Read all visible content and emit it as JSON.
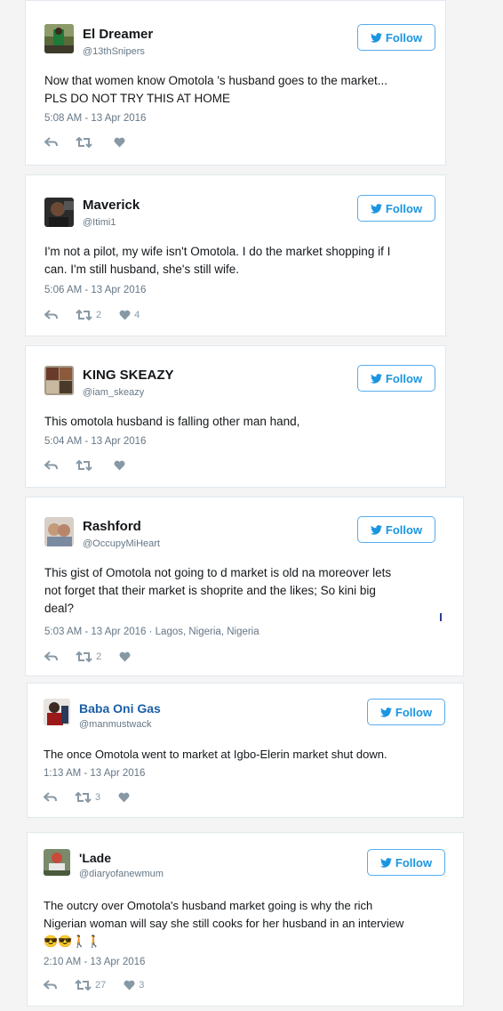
{
  "follow_label": "Follow",
  "icons": {
    "follow": "twitter-bird-icon",
    "reply": "reply-icon",
    "retweet": "retweet-icon",
    "like": "heart-icon"
  },
  "colors": {
    "accent": "#1b95e0",
    "name_blue": "#1b5ea6",
    "muted": "#657786"
  },
  "tweets": [
    {
      "name": "El Dreamer",
      "handle": "@13thSnipers",
      "text": [
        "Now that women know Omotola 's husband goes to the market...",
        "PLS DO NOT TRY THIS AT HOME"
      ],
      "time": "5:08 AM - 13 Apr 2016",
      "retweets": "",
      "likes": ""
    },
    {
      "name": "Maverick",
      "handle": "@Itimi1",
      "text": [
        "I'm not a pilot, my wife isn't Omotola. I do the market shopping if I",
        "can. I'm still husband, she's still wife."
      ],
      "time": "5:06 AM - 13 Apr 2016",
      "retweets": "2",
      "likes": "4"
    },
    {
      "name": "KING SKEAZY",
      "handle": "@iam_skeazy",
      "text": [
        "This omotola husband is falling other man hand,"
      ],
      "time": "5:04 AM - 13 Apr 2016",
      "retweets": "",
      "likes": ""
    },
    {
      "name": "Rashford",
      "handle": "@OccupyMiHeart",
      "text": [
        "This gist of Omotola not going to d market is old na moreover lets",
        "not forget that their market is shoprite and the likes; So kini big",
        "deal?"
      ],
      "time": "5:03 AM - 13 Apr 2016 · Lagos, Nigeria, Nigeria",
      "retweets": "2",
      "likes": ""
    },
    {
      "name": "Baba Oni Gas",
      "handle": "@manmustwack",
      "text": [
        "The once Omotola went to market at Igbo-Elerin market shut down."
      ],
      "time": "1:13 AM - 13 Apr 2016",
      "retweets": "3",
      "likes": ""
    },
    {
      "name": "'Lade",
      "handle": "@diaryofanewmum",
      "text": [
        "The outcry over Omotola's husband market going is why the rich",
        "Nigerian woman will say she still cooks for her husband in an interview",
        "😎😎🚶🚶"
      ],
      "time": "2:10 AM - 13 Apr 2016",
      "retweets": "27",
      "likes": "3"
    }
  ]
}
